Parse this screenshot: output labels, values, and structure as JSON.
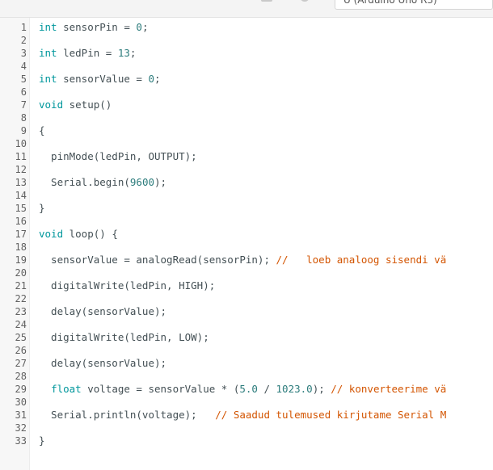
{
  "toolbar": {
    "board_select_label": "U (Arduino Uno R3)",
    "icons": [
      "verify-icon",
      "upload-icon"
    ]
  },
  "colors": {
    "keyword": "#00979c",
    "number": "#2c7c7c",
    "comment": "#d35400",
    "text": "#434f54",
    "line_number": "#616161"
  },
  "editor": {
    "line_numbers": [
      "1",
      "2",
      "3",
      "4",
      "5",
      "6",
      "7",
      "8",
      "9",
      "10",
      "11",
      "12",
      "13",
      "14",
      "15",
      "16",
      "17",
      "18",
      "19",
      "20",
      "21",
      "22",
      "23",
      "24",
      "25",
      "26",
      "27",
      "28",
      "29",
      "30",
      "31",
      "32",
      "33"
    ],
    "lines": [
      {
        "n": "1",
        "tokens": [
          {
            "t": "int",
            "c": "kw"
          },
          {
            "t": " sensorPin = ",
            "c": "fn"
          },
          {
            "t": "0",
            "c": "num"
          },
          {
            "t": ";",
            "c": "fn"
          }
        ]
      },
      {
        "n": "3",
        "tokens": [
          {
            "t": "int",
            "c": "kw"
          },
          {
            "t": " ledPin = ",
            "c": "fn"
          },
          {
            "t": "13",
            "c": "num"
          },
          {
            "t": ";",
            "c": "fn"
          }
        ]
      },
      {
        "n": "5",
        "tokens": [
          {
            "t": "int",
            "c": "kw"
          },
          {
            "t": " sensorValue = ",
            "c": "fn"
          },
          {
            "t": "0",
            "c": "num"
          },
          {
            "t": ";",
            "c": "fn"
          }
        ]
      },
      {
        "n": "7",
        "tokens": [
          {
            "t": "void",
            "c": "kw"
          },
          {
            "t": " setup()",
            "c": "fn"
          }
        ]
      },
      {
        "n": "9",
        "tokens": [
          {
            "t": "{",
            "c": "fn"
          }
        ]
      },
      {
        "n": "11",
        "tokens": [
          {
            "t": "  pinMode(ledPin, OUTPUT);",
            "c": "fn"
          }
        ]
      },
      {
        "n": "13",
        "tokens": [
          {
            "t": "  Serial.begin(",
            "c": "fn"
          },
          {
            "t": "9600",
            "c": "num"
          },
          {
            "t": ");",
            "c": "fn"
          }
        ]
      },
      {
        "n": "15",
        "tokens": [
          {
            "t": "}",
            "c": "fn"
          }
        ]
      },
      {
        "n": "17",
        "tokens": [
          {
            "t": "void",
            "c": "kw"
          },
          {
            "t": " loop() {",
            "c": "fn"
          }
        ]
      },
      {
        "n": "19",
        "tokens": [
          {
            "t": "  sensorValue = analogRead(sensorPin); ",
            "c": "fn"
          },
          {
            "t": "//   loeb analoog sisendi vä",
            "c": "cm"
          }
        ]
      },
      {
        "n": "21",
        "tokens": [
          {
            "t": "  digitalWrite(ledPin, HIGH);",
            "c": "fn"
          }
        ]
      },
      {
        "n": "23",
        "tokens": [
          {
            "t": "  delay(sensorValue);",
            "c": "fn"
          }
        ]
      },
      {
        "n": "25",
        "tokens": [
          {
            "t": "  digitalWrite(ledPin, LOW);",
            "c": "fn"
          }
        ]
      },
      {
        "n": "27",
        "tokens": [
          {
            "t": "  delay(sensorValue);",
            "c": "fn"
          }
        ]
      },
      {
        "n": "29",
        "tokens": [
          {
            "t": "  ",
            "c": "fn"
          },
          {
            "t": "float",
            "c": "kw"
          },
          {
            "t": " voltage = sensorValue * (",
            "c": "fn"
          },
          {
            "t": "5.0",
            "c": "num"
          },
          {
            "t": " / ",
            "c": "fn"
          },
          {
            "t": "1023.0",
            "c": "num"
          },
          {
            "t": "); ",
            "c": "fn"
          },
          {
            "t": "// konverteerime vä",
            "c": "cm"
          }
        ]
      },
      {
        "n": "31",
        "tokens": [
          {
            "t": "  Serial.println(voltage);   ",
            "c": "fn"
          },
          {
            "t": "// Saadud tulemused kirjutame Serial M",
            "c": "cm"
          }
        ]
      },
      {
        "n": "33",
        "tokens": [
          {
            "t": "}",
            "c": "fn"
          }
        ]
      }
    ]
  }
}
